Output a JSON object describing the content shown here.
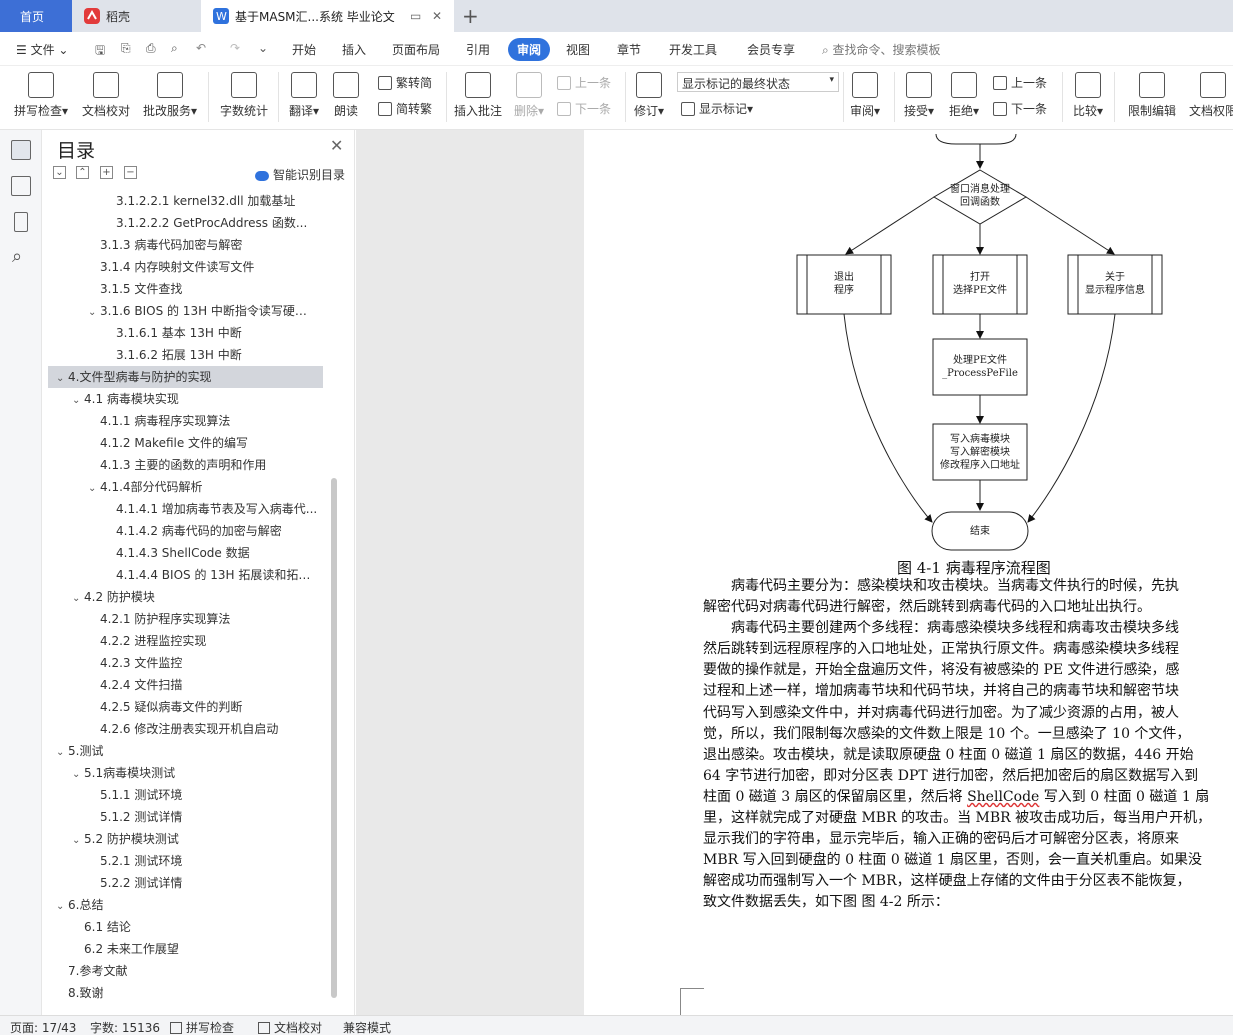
{
  "tabs": {
    "home": "首页",
    "daoke": "稻壳",
    "doc": "基于MASM汇...系统 毕业论文",
    "add": "+"
  },
  "menu": {
    "file": "文件",
    "items": [
      "开始",
      "插入",
      "页面布局",
      "引用",
      "审阅",
      "视图",
      "章节",
      "开发工具",
      "会员专享"
    ],
    "search": "查找命令、搜索模板"
  },
  "ribbon": {
    "spell": "拼写检查",
    "proof": "文档校对",
    "annot_service": "批改服务",
    "wordcount": "字数统计",
    "translate": "翻译",
    "read": "朗读",
    "trad": "繁转简",
    "simp": "简转繁",
    "insert_comment": "插入批注",
    "delete": "删除",
    "prev_c": "上一条",
    "next_c": "下一条",
    "revise": "修订",
    "markup_state": "显示标记的最终状态",
    "show_markup": "显示标记",
    "review": "审阅",
    "accept": "接受",
    "reject": "拒绝",
    "prev": "上一条",
    "next": "下一条",
    "compare": "比较",
    "restrict": "限制编辑",
    "permission": "文档权限"
  },
  "toc": {
    "title": "目录",
    "smart": "智能识别目录",
    "items": [
      {
        "text": "3.1.2.2.1 kernel32.dll 加载基址",
        "level": 4,
        "chev": ""
      },
      {
        "text": "3.1.2.2.2 GetProcAddress 函数...",
        "level": 4,
        "chev": ""
      },
      {
        "text": "3.1.3  病毒代码加密与解密",
        "level": 3,
        "chev": ""
      },
      {
        "text": "3.1.4  内存映射文件读写文件",
        "level": 3,
        "chev": ""
      },
      {
        "text": "3.1.5  文件查找",
        "level": 3,
        "chev": ""
      },
      {
        "text": "3.1.6 BIOS 的 13H 中断指令读写硬盘 ...",
        "level": 3,
        "chev": "v"
      },
      {
        "text": "3.1.6.1  基本 13H 中断",
        "level": 4,
        "chev": ""
      },
      {
        "text": "3.1.6.2  拓展 13H 中断",
        "level": 4,
        "chev": ""
      },
      {
        "text": "4.文件型病毒与防护的实现",
        "level": 1,
        "chev": "v",
        "selected": true
      },
      {
        "text": "4.1  病毒模块实现",
        "level": 2,
        "chev": "v"
      },
      {
        "text": "4.1.1  病毒程序实现算法",
        "level": 3,
        "chev": ""
      },
      {
        "text": "4.1.2 Makefile 文件的编写",
        "level": 3,
        "chev": ""
      },
      {
        "text": "4.1.3  主要的函数的声明和作用",
        "level": 3,
        "chev": ""
      },
      {
        "text": "4.1.4部分代码解析",
        "level": 3,
        "chev": "v"
      },
      {
        "text": "4.1.4.1  增加病毒节表及写入病毒代...",
        "level": 4,
        "chev": ""
      },
      {
        "text": "4.1.4.2  病毒代码的加密与解密",
        "level": 4,
        "chev": ""
      },
      {
        "text": "4.1.4.3 ShellCode 数据",
        "level": 4,
        "chev": ""
      },
      {
        "text": "4.1.4.4 BIOS 的 13H 拓展读和拓展...",
        "level": 4,
        "chev": ""
      },
      {
        "text": "4.2  防护模块",
        "level": 2,
        "chev": "v"
      },
      {
        "text": "4.2.1  防护程序实现算法",
        "level": 3,
        "chev": ""
      },
      {
        "text": "4.2.2  进程监控实现",
        "level": 3,
        "chev": ""
      },
      {
        "text": "4.2.3  文件监控",
        "level": 3,
        "chev": ""
      },
      {
        "text": "4.2.4  文件扫描",
        "level": 3,
        "chev": ""
      },
      {
        "text": "4.2.5  疑似病毒文件的判断",
        "level": 3,
        "chev": ""
      },
      {
        "text": "4.2.6  修改注册表实现开机自启动",
        "level": 3,
        "chev": ""
      },
      {
        "text": "5.测试",
        "level": 1,
        "chev": "v"
      },
      {
        "text": "5.1病毒模块测试",
        "level": 2,
        "chev": "v"
      },
      {
        "text": "5.1.1  测试环境",
        "level": 3,
        "chev": ""
      },
      {
        "text": "5.1.2  测试详情",
        "level": 3,
        "chev": ""
      },
      {
        "text": "5.2  防护模块测试",
        "level": 2,
        "chev": "v"
      },
      {
        "text": "5.2.1  测试环境",
        "level": 3,
        "chev": ""
      },
      {
        "text": "5.2.2  测试详情",
        "level": 3,
        "chev": ""
      },
      {
        "text": "6.总结",
        "level": 1,
        "chev": "v"
      },
      {
        "text": "6.1  结论",
        "level": 2,
        "chev": ""
      },
      {
        "text": "6.2  未来工作展望",
        "level": 2,
        "chev": ""
      },
      {
        "text": "7.参考文献",
        "level": 1,
        "chev": ""
      },
      {
        "text": "8.致谢",
        "level": 1,
        "chev": ""
      }
    ]
  },
  "flowchart": {
    "decision": [
      "窗口消息处理",
      "回调函数"
    ],
    "box_exit": [
      "退出",
      "程序"
    ],
    "box_open": [
      "打开",
      "选择PE文件"
    ],
    "box_about": [
      "关于",
      "显示程序信息"
    ],
    "box_process": [
      "处理PE文件",
      "_ProcessPeFile"
    ],
    "box_write": [
      "写入病毒模块",
      "写入解密模块",
      "修改程序入口地址"
    ],
    "end": "结束"
  },
  "document": {
    "caption": "图 4-1 病毒程序流程图",
    "lines": [
      "　　病毒代码主要分为：感染模块和攻击模块。当病毒文件执行的时候，先执",
      "解密代码对病毒代码进行解密，然后跳转到病毒代码的入口地址出执行。",
      "　　病毒代码主要创建两个多线程：病毒感染模块多线程和病毒攻击模块多线",
      "然后跳转到远程原程序的入口地址处，正常执行原文件。病毒感染模块多线程",
      "要做的操作就是，开始全盘遍历文件，将没有被感染的 PE 文件进行感染，感",
      "过程和上述一样，增加病毒节块和代码节块，并将自己的病毒节块和解密节块",
      "代码写入到感染文件中，并对病毒代码进行加密。为了减少资源的占用，被人",
      "觉，所以，我们限制每次感染的文件数上限是 10 个。一旦感染了 10 个文件，",
      "退出感染。攻击模块，就是读取原硬盘 0 柱面 0 磁道 1 扇区的数据，446 开始",
      "64 字节进行加密，即对分区表 DPT 进行加密，然后把加密后的扇区数据写入到",
      "柱面 0 磁道 3 扇区的保留扇区里，然后将 ",
      "里，这样就完成了对硬盘 MBR 的攻击。当 MBR 被攻击成功后，每当用户开机，",
      "显示我们的字符串，显示完毕后，输入正确的密码后才可解密分区表，将原来",
      "MBR 写入回到硬盘的 0 柱面 0 磁道 1 扇区里，否则，会一直关机重启。如果没",
      "解密成功而强制写入一个 MBR，这样硬盘上存储的文件由于分区表不能恢复，",
      "致文件数据丢失，如下图 图 4-2 所示："
    ],
    "shellcode": "ShellCode",
    "line11_tail": " 写入到 0 柱面 0 磁道 1 扇"
  },
  "status": {
    "page": "页面: 17/43",
    "words": "字数: 15136",
    "spell": "拼写检查",
    "proof": "文档校对",
    "compat": "兼容模式"
  }
}
